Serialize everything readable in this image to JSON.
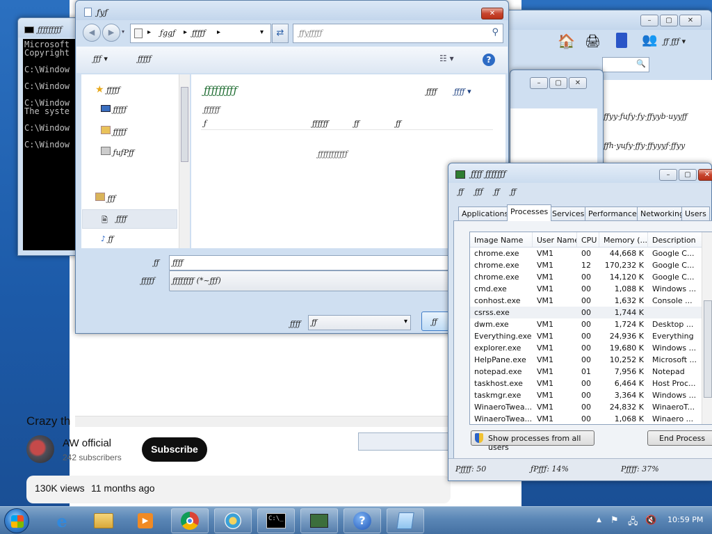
{
  "youtube": {
    "title": "Crazy th",
    "channel": "AW official",
    "subscribers": "242 subscribers",
    "subscribe_label": "Subscribe",
    "views": "130K views",
    "age": "11 months ago"
  },
  "cmd": {
    "lines": [
      "Microsoft",
      "Copyright",
      "",
      "C:\\Window",
      "",
      "C:\\Window",
      "",
      "C:\\Window",
      "The syste",
      "",
      "C:\\Window",
      "",
      "C:\\Window"
    ]
  },
  "bg_explorer": {
    "right_text_1": "ƒƒyy·ƒuƒy·ƒy·ƒƒyyb·uyyƒƒ",
    "right_text_2": "ƒƒh·yuƒy·ƒƒy·ƒƒyyyƒ·ƒƒyy"
  },
  "save_dialog": {
    "title": "ƒyƒ",
    "breadcrumb": [
      "ƒggƒ",
      "ƒƒƒƒƒ"
    ],
    "search_placeholder": "ƒƒyƒƒƒƒƒ",
    "toolbar": {
      "organize": "ƒƒƒ",
      "new_folder": "ƒƒƒƒƒ"
    },
    "nav": {
      "favorites": "ƒƒƒƒƒ",
      "desktop": "ƒƒƒƒƒ",
      "downloads": "ƒƒƒƒƒ",
      "recent": "ƒuƒPƒƒ",
      "libraries": "ƒƒƒ",
      "documents": "ƒƒƒƒ",
      "music": "ƒƒ"
    },
    "library_title": "ƒƒƒƒƒƒƒƒƒ",
    "library_sub": "ƒƒƒƒƒƒ",
    "arrange_by": "ƒƒƒƒ",
    "arrange_value": "ƒƒƒƒ",
    "columns": [
      "ƒ",
      "ƒƒƒƒƒƒ",
      "ƒƒ",
      "ƒƒ"
    ],
    "empty_msg": "ƒƒƒƒƒƒƒƒƒƒƒ",
    "filename_label": "ƒƒ",
    "filename_value": "ƒƒƒƒ",
    "savetype_label": "ƒƒƒƒƒ",
    "savetype_value": "ƒƒƒƒƒƒƒƒ (*~ƒƒƒ)",
    "encoding_label": "ƒƒƒƒ",
    "encoding_value": "ƒƒ",
    "save_button": "ƒƒ"
  },
  "task_manager": {
    "title": "ƒƒƒƒ ƒƒƒƒƒƒƒ",
    "menu": [
      "ƒƒ",
      "ƒƒƒ",
      "ƒƒ",
      "ƒƒ"
    ],
    "tabs": [
      "Applications",
      "Processes",
      "Services",
      "Performance",
      "Networking",
      "Users"
    ],
    "columns": [
      "Image Name",
      "User Name",
      "CPU",
      "Memory (...",
      "Description"
    ],
    "rows": [
      [
        "chrome.exe",
        "VM1",
        "00",
        "44,668 K",
        "Google C..."
      ],
      [
        "chrome.exe",
        "VM1",
        "12",
        "170,232 K",
        "Google C..."
      ],
      [
        "chrome.exe",
        "VM1",
        "00",
        "14,120 K",
        "Google C..."
      ],
      [
        "cmd.exe",
        "VM1",
        "00",
        "1,088 K",
        "Windows ..."
      ],
      [
        "conhost.exe",
        "VM1",
        "00",
        "1,632 K",
        "Console ..."
      ],
      [
        "csrss.exe",
        "",
        "00",
        "1,744 K",
        ""
      ],
      [
        "dwm.exe",
        "VM1",
        "00",
        "1,724 K",
        "Desktop ..."
      ],
      [
        "Everything.exe",
        "VM1",
        "00",
        "24,936 K",
        "Everything"
      ],
      [
        "explorer.exe",
        "VM1",
        "00",
        "19,680 K",
        "Windows ..."
      ],
      [
        "HelpPane.exe",
        "VM1",
        "00",
        "10,252 K",
        "Microsoft ..."
      ],
      [
        "notepad.exe",
        "VM1",
        "01",
        "7,956 K",
        "Notepad"
      ],
      [
        "taskhost.exe",
        "VM1",
        "00",
        "6,464 K",
        "Host Proc..."
      ],
      [
        "taskmgr.exe",
        "VM1",
        "00",
        "3,364 K",
        "Windows ..."
      ],
      [
        "WinaeroTwea...",
        "VM1",
        "00",
        "24,832 K",
        "WinaeroT..."
      ],
      [
        "WinaeroTwea...",
        "VM1",
        "00",
        "1,068 K",
        "Winaero ..."
      ]
    ],
    "show_all_label": "Show processes from all users",
    "end_process_label": "End Process",
    "status": {
      "processes": "Pƒƒƒƒ: 50",
      "cpu": "ƒPƒƒƒ: 14%",
      "memory": "Pƒƒƒƒ: 37%"
    }
  },
  "taskbar": {
    "clock": "10:59 PM"
  },
  "colors": {
    "accent": "#1f5fa8",
    "taskbar": "#5a86b6",
    "subscribe_bg": "#0f0f0f"
  }
}
